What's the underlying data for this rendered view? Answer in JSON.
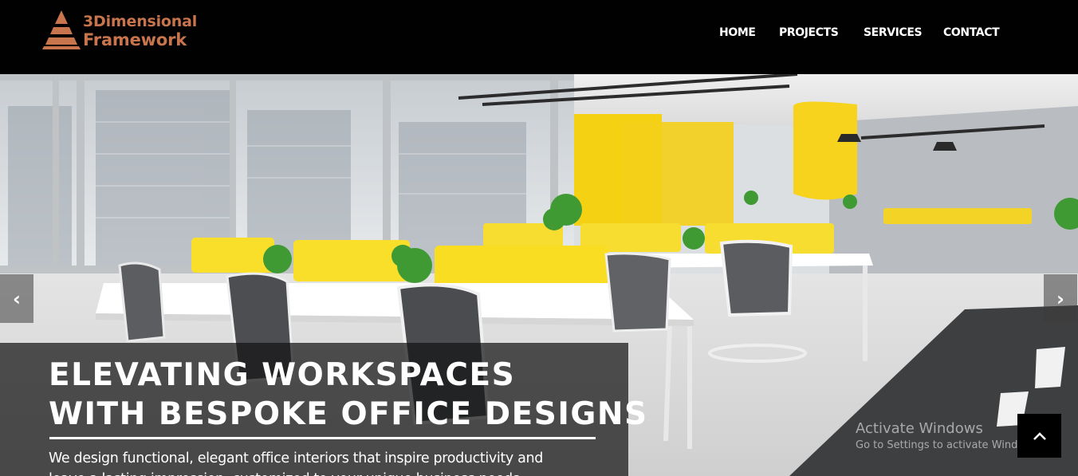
{
  "brand": {
    "line1": "3Dimensional",
    "line2": "Framework",
    "color": "#c8744c"
  },
  "nav": {
    "items": [
      {
        "label": "HOME"
      },
      {
        "label": "PROJECTS"
      },
      {
        "label": "SERVICES"
      },
      {
        "label": "CONTACT"
      }
    ]
  },
  "hero": {
    "headline_line1": "ELEVATING WORKSPACES",
    "headline_line2": "WITH BESPOKE OFFICE DESIGNS",
    "tagline_line1": "We design functional, elegant office interiors that inspire productivity and",
    "tagline_line2": "leave a lasting impression, customized to your unique business needs.",
    "prev_icon": "‹",
    "next_icon": "›",
    "accent_color": "#f7d31e"
  },
  "watermark": {
    "title": "Activate Windows",
    "subtitle": "Go to Settings to activate Windows."
  },
  "back_to_top": {
    "icon": "chevron-up-icon"
  }
}
